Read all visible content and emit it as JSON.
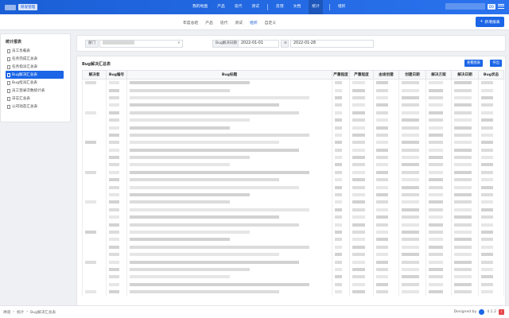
{
  "app": {
    "name": "研发管理"
  },
  "main_nav": {
    "items": [
      "我的地盘",
      "产品",
      "迭代",
      "测试",
      "反馈",
      "文档",
      "统计",
      "组织"
    ],
    "active": "统计"
  },
  "top_right": {
    "user": "DO"
  },
  "sub_nav": {
    "items": [
      "年度总结",
      "产品",
      "迭代",
      "测试",
      "组织",
      "自定义"
    ],
    "active": "组织",
    "new_button": "新增报表"
  },
  "sidebar": {
    "title": "统计报表",
    "items": [
      "员工负载表",
      "任务完成汇总表",
      "任务指派汇总表",
      "Bug解决汇总表",
      "Bug指派汇总表",
      "员工登录次数统计表",
      "日志汇总表",
      "公司动态汇总表"
    ],
    "active_index": 3
  },
  "filters": {
    "dept_label": "部门",
    "date_label": "Bug解决日期",
    "start_date": "2022-01-01",
    "end_date": "2022-01-28"
  },
  "panel": {
    "title": "Bug解决汇总表",
    "buttons": {
      "view_chart": "查看图表",
      "export": "导出"
    },
    "columns": [
      "解决者",
      "Bug编号",
      "Bug标题",
      "严重程度",
      "严重程度",
      "由谁创建",
      "创建日期",
      "解决方案",
      "解决日期",
      "Bug状态"
    ],
    "row_count": 29
  },
  "footer": {
    "breadcrumb": [
      "禅道",
      "统计",
      "Bug解决汇总表"
    ],
    "designed_by": "Designed by",
    "version": "4.1.2"
  }
}
